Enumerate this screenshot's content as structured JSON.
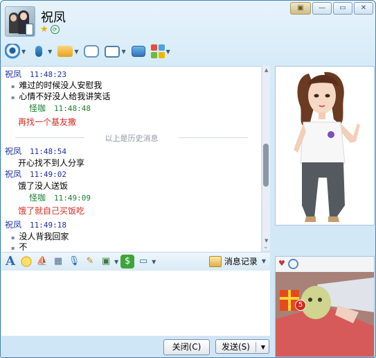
{
  "window": {
    "title": "祝凤"
  },
  "window_controls": {
    "skin": "▣",
    "minimize": "—",
    "maximize": "▭",
    "close": "✕"
  },
  "toolbar": {
    "items": [
      {
        "name": "video-call",
        "icon": "webcam-icon"
      },
      {
        "name": "voice-call",
        "icon": "microphone-icon"
      },
      {
        "name": "send-file",
        "icon": "folder-icon"
      },
      {
        "name": "create-group-chat",
        "icon": "chat-bubble-icon"
      },
      {
        "name": "remote-assist",
        "icon": "monitor-icon"
      },
      {
        "name": "share-screen",
        "icon": "screen-share-icon"
      },
      {
        "name": "apps",
        "icon": "apps-grid-icon"
      }
    ]
  },
  "chat": {
    "messages": [
      {
        "sender": "祝凤",
        "time": "11:48:23"
      },
      {
        "text": "难过的时候没人安慰我"
      },
      {
        "text": "心情不好没人给我讲笑话"
      },
      {
        "sender": "怪咖",
        "time": "11:48:48"
      },
      {
        "text": "再找一个基友撒"
      },
      {
        "divider": "以上是历史消息"
      },
      {
        "sender": "祝凤",
        "time": "11:48:54"
      },
      {
        "text": "开心找不到人分享"
      },
      {
        "sender": "祝凤",
        "time": "11:49:02"
      },
      {
        "text": "饿了没人送饭"
      },
      {
        "sender": "怪咖",
        "time": "11:49:09"
      },
      {
        "text": "饿了就自己买饭吃"
      },
      {
        "sender": "祝凤",
        "time": "11:49:18"
      },
      {
        "text": "没人背我回家"
      },
      {
        "text": "不"
      }
    ]
  },
  "input_toolbar": {
    "history_label": "消息记录"
  },
  "buttons": {
    "close": "关闭(C)",
    "send": "发送(S)"
  },
  "camera": {
    "badge": "5"
  },
  "colors": {
    "window_border": "#4a7fb0",
    "sender_blue": "#1a2fa8",
    "me_green": "#1a8030",
    "my_msg_red": "#d62a1f"
  }
}
